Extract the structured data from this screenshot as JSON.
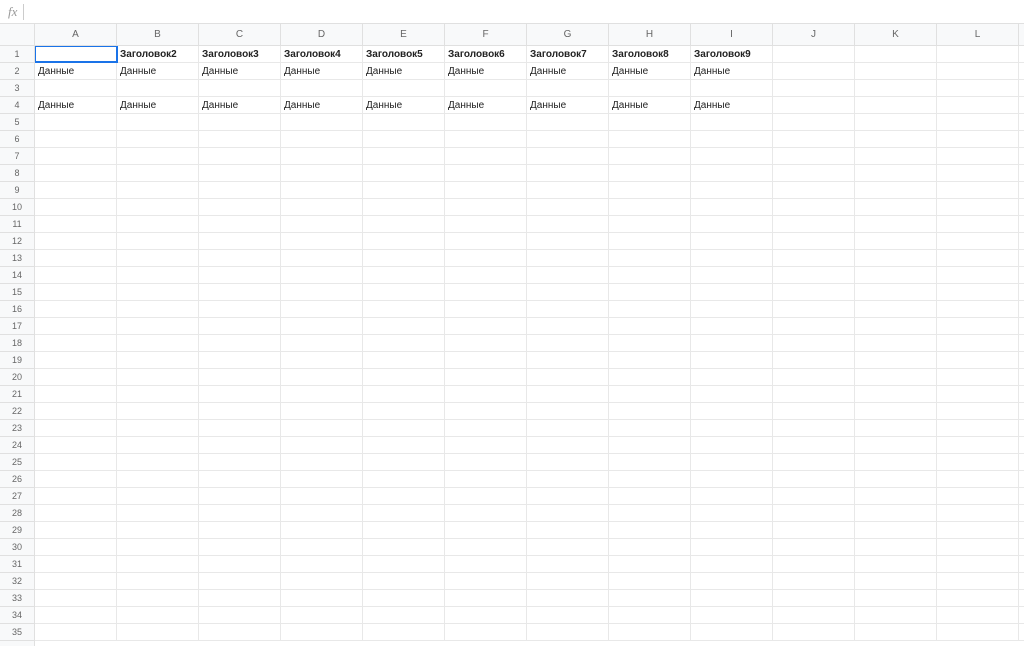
{
  "formulaBar": {
    "fxLabel": "fx",
    "value": ""
  },
  "columns": [
    "A",
    "B",
    "C",
    "D",
    "E",
    "F",
    "G",
    "H",
    "I",
    "J",
    "K",
    "L"
  ],
  "rowCount": 35,
  "selected": {
    "row": 1,
    "col": 0
  },
  "cells": {
    "r1": {
      "c1": {
        "text": "Заголовок2",
        "bold": true
      },
      "c2": {
        "text": "Заголовок3",
        "bold": true
      },
      "c3": {
        "text": "Заголовок4",
        "bold": true
      },
      "c4": {
        "text": "Заголовок5",
        "bold": true
      },
      "c5": {
        "text": "Заголовок6",
        "bold": true
      },
      "c6": {
        "text": "Заголовок7",
        "bold": true
      },
      "c7": {
        "text": "Заголовок8",
        "bold": true
      },
      "c8": {
        "text": "Заголовок9",
        "bold": true
      }
    },
    "r2": {
      "c0": {
        "text": "Данные"
      },
      "c1": {
        "text": "Данные"
      },
      "c2": {
        "text": "Данные"
      },
      "c3": {
        "text": "Данные"
      },
      "c4": {
        "text": "Данные"
      },
      "c5": {
        "text": "Данные"
      },
      "c6": {
        "text": "Данные"
      },
      "c7": {
        "text": "Данные"
      },
      "c8": {
        "text": "Данные"
      }
    },
    "r4": {
      "c0": {
        "text": "Данные"
      },
      "c1": {
        "text": "Данные"
      },
      "c2": {
        "text": "Данные"
      },
      "c3": {
        "text": "Данные"
      },
      "c4": {
        "text": "Данные"
      },
      "c5": {
        "text": "Данные"
      },
      "c6": {
        "text": "Данные"
      },
      "c7": {
        "text": "Данные"
      },
      "c8": {
        "text": "Данные"
      }
    }
  }
}
